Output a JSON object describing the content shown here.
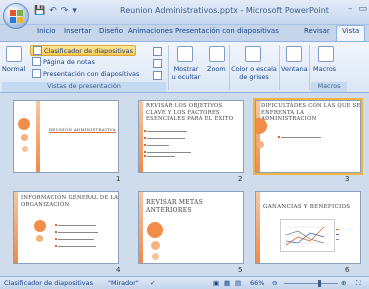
{
  "app": {
    "title": "Reunion Administrativos.pptx - Microsoft PowerPoint",
    "window_minimize": "–",
    "window_restore": "▭"
  },
  "qat": {
    "save": "💾",
    "undo": "↶",
    "redo": "↷",
    "more": "▾"
  },
  "tabs": [
    "Inicio",
    "Insertar",
    "Diseño",
    "Animaciones",
    "Presentación con diapositivas",
    "Revisar",
    "Vista"
  ],
  "active_tab": "Vista",
  "ribbon": {
    "normal": "Normal",
    "sorter": "Clasificador de diapositivas",
    "notes": "Página de notas",
    "slideshow": "Presentación con diapositivas",
    "group_views": "Vistas de presentación",
    "show_hide": "Mostrar u ocultar",
    "zoom": "Zoom",
    "color": "Color o escala de grises",
    "window": "Ventana",
    "macros": "Macros",
    "group_macros": "Macros"
  },
  "slides": [
    {
      "number": "1",
      "title": "Reunión administrativa",
      "bullets": 0
    },
    {
      "number": "2",
      "title": "Revisar los objetivos clave y los factores esenciales para el éxito",
      "bullets": 4
    },
    {
      "number": "3",
      "title": "Dificultades con las que se enfrenta la administración",
      "bullets": 1
    },
    {
      "number": "4",
      "title": "Información General de la Organización",
      "bullets": 4
    },
    {
      "number": "5",
      "title": "Revisar Metas Anteriores",
      "bullets": 0
    },
    {
      "number": "6",
      "title": "Ganancias y Beneficios",
      "bullets": 0
    }
  ],
  "status": {
    "view": "Clasificador de diapositivas",
    "theme": "\"Mirador\"",
    "zoom": "66%"
  },
  "colors": {
    "accent_orange": "#f08a4b",
    "selection": "#f3b541",
    "ribbon_blue": "#15428b"
  }
}
